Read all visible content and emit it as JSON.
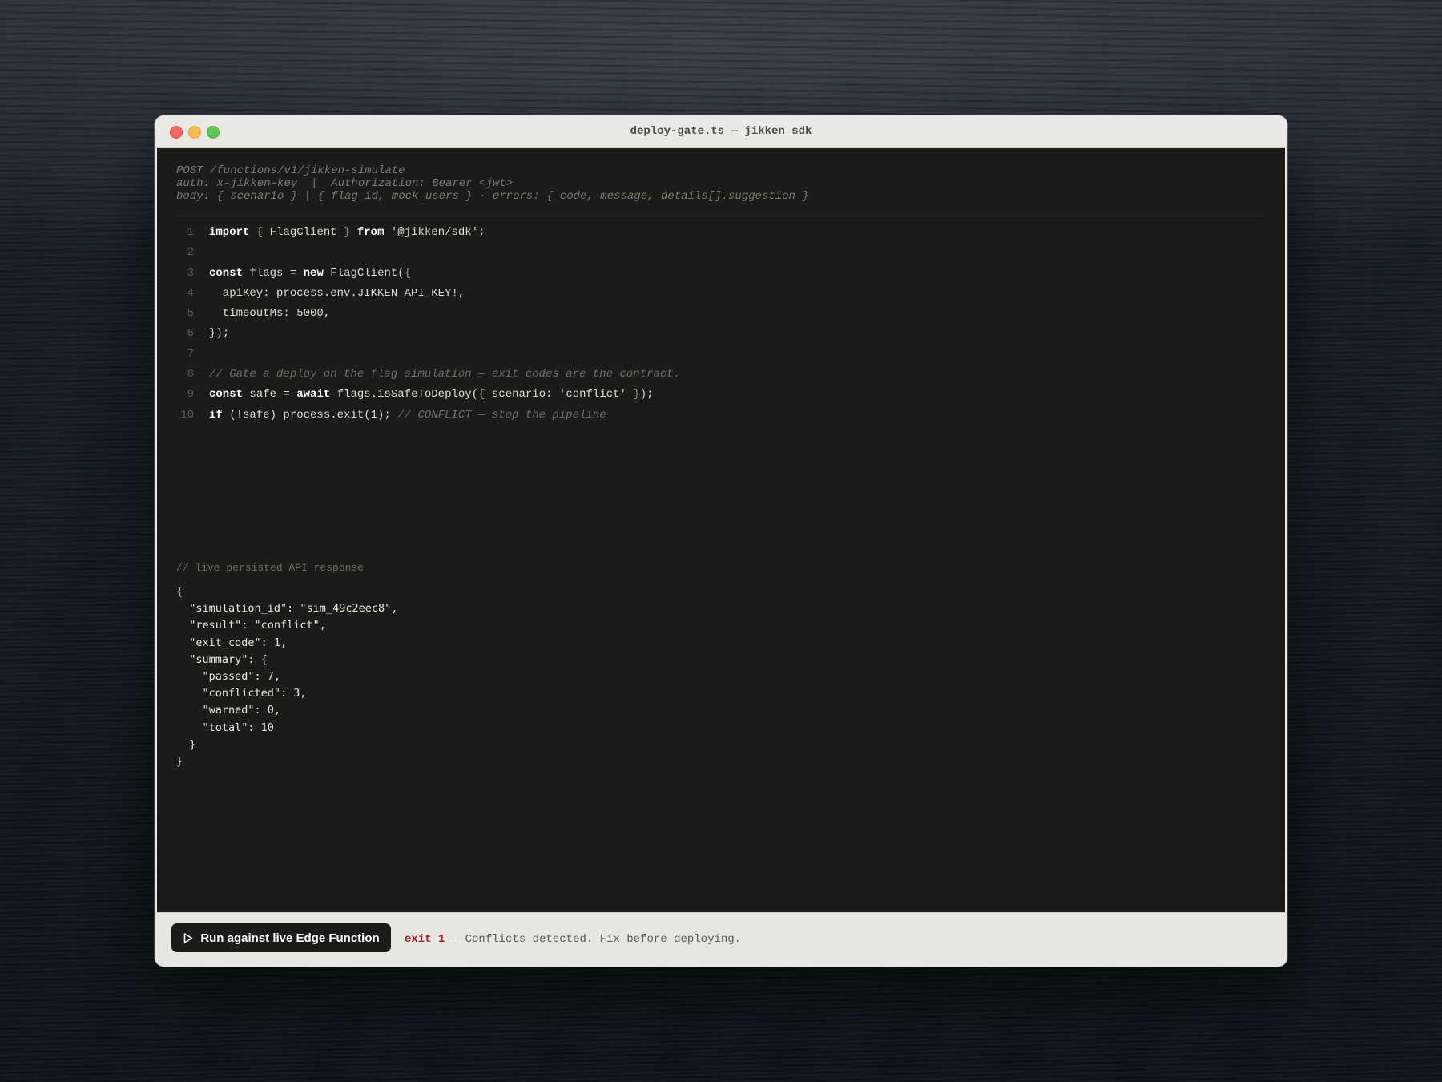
{
  "window": {
    "title": "deploy-gate.ts — jikken sdk"
  },
  "request_meta": [
    "POST /functions/v1/jikken-simulate",
    "auth: x-jikken-key  |  Authorization: Bearer <jwt>",
    "body: { scenario } | { flag_id, mock_users } · errors: { code, message, details[].suggestion }"
  ],
  "code": {
    "line_numbers": [
      "1",
      "2",
      "3",
      "4",
      "5",
      "6",
      "7",
      "8",
      "9",
      "10"
    ],
    "lines": [
      {
        "t1": "import",
        "t2": " { ",
        "t3": "FlagClient",
        "t4": " } ",
        "t5": "from",
        "t6": " '@jikken/sdk';"
      },
      {},
      {
        "t1": "const",
        "t2": " flags = ",
        "t3": "new",
        "t4": " FlagClient(",
        "t5": "{"
      },
      {
        "t1": "  apiKey: process.env.JIKKEN_API_KEY!,"
      },
      {
        "t1": "  timeoutMs: 5000,"
      },
      {
        "t1": "});"
      },
      {},
      {
        "t1": "// Gate a deploy on the flag simulation — exit codes are the contract."
      },
      {
        "t1": "const",
        "t2": " safe = ",
        "t3": "await",
        "t4": " flags.isSafeToDeploy(",
        "t5": "{",
        "t6": " scenario: 'conflict' ",
        "t7": "}",
        "t8": ");"
      },
      {
        "t1": "if",
        "t2": " (!safe) process.exit(1); ",
        "t3": "// CONFLICT — stop the pipeline"
      }
    ]
  },
  "response": {
    "label": "// live persisted API response",
    "json_lines": [
      "{",
      "  \"simulation_id\": \"sim_49c2eec8\",",
      "  \"result\": \"conflict\",",
      "  \"exit_code\": 1,",
      "  \"summary\": {",
      "    \"passed\": 7,",
      "    \"conflicted\": 3,",
      "    \"warned\": 0,",
      "    \"total\": 10",
      "  }",
      "}"
    ]
  },
  "footer": {
    "run_button_label": "Run against live Edge Function",
    "run_icon": "play-icon",
    "status_exit": "exit 1",
    "status_message": " — Conflicts detected. Fix before deploying."
  },
  "colors": {
    "editor_bg": "#1c1b19",
    "exit_red": "#a31d1d",
    "button_bg": "#1c1b1a"
  }
}
